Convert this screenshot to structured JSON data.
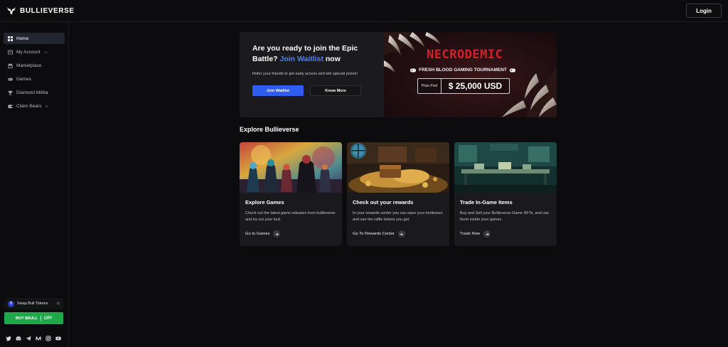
{
  "header": {
    "brand": "BULLIEVERSE",
    "login_label": "Login"
  },
  "sidebar": {
    "items": [
      {
        "label": "Home",
        "icon": "grid-icon",
        "active": true
      },
      {
        "label": "My Account",
        "icon": "user-icon",
        "has_dropdown": true
      },
      {
        "label": "Marketplace",
        "icon": "store-icon"
      },
      {
        "label": "Games",
        "icon": "gamepad-icon"
      },
      {
        "label": "Diamond Militia",
        "icon": "trophy-icon"
      },
      {
        "label": "Claim Bears",
        "icon": "wallet-icon",
        "has_dropdown": true
      }
    ],
    "swap_label": "Swap Bull Tokens",
    "buy_label": "BUY $BULL",
    "buy_partner": "UP!",
    "socials": [
      "twitter-icon",
      "discord-icon",
      "telegram-icon",
      "medium-icon",
      "instagram-icon",
      "youtube-icon"
    ]
  },
  "banner": {
    "title_part1": "Are you ready to join the Epic Battle? ",
    "title_link": "Join Waitlist",
    "title_part2": " now",
    "subtitle": "Refer your friends to get early access and win special prizes!",
    "primary_button": "Join Waitlist",
    "secondary_button": "Know More",
    "game_logo": "NECRODEMIC",
    "tournament": "FRESH BLOOD GAMING TOURNAMENT",
    "prize_label": "Prize Pool",
    "prize_amount": "$ 25,000 USD",
    "colors": {
      "accent": "#2f5cf3",
      "logo_red": "#d3202a"
    }
  },
  "explore": {
    "title": "Explore Bullieverse",
    "cards": [
      {
        "title": "Explore Games",
        "text": "Check out the latest game releases from bullieverse and try out your luck",
        "link": "Go to Games"
      },
      {
        "title": "Check out your rewards",
        "text": "In your rewards center you can open your lootboxes and see the raffle tickets you got.",
        "link": "Go To Rewards Center"
      },
      {
        "title": "Trade In-Game Items",
        "text": "Buy and Sell your Bullieverse Game NFTs, and use them inside your games",
        "link": "Trade Now"
      }
    ]
  }
}
